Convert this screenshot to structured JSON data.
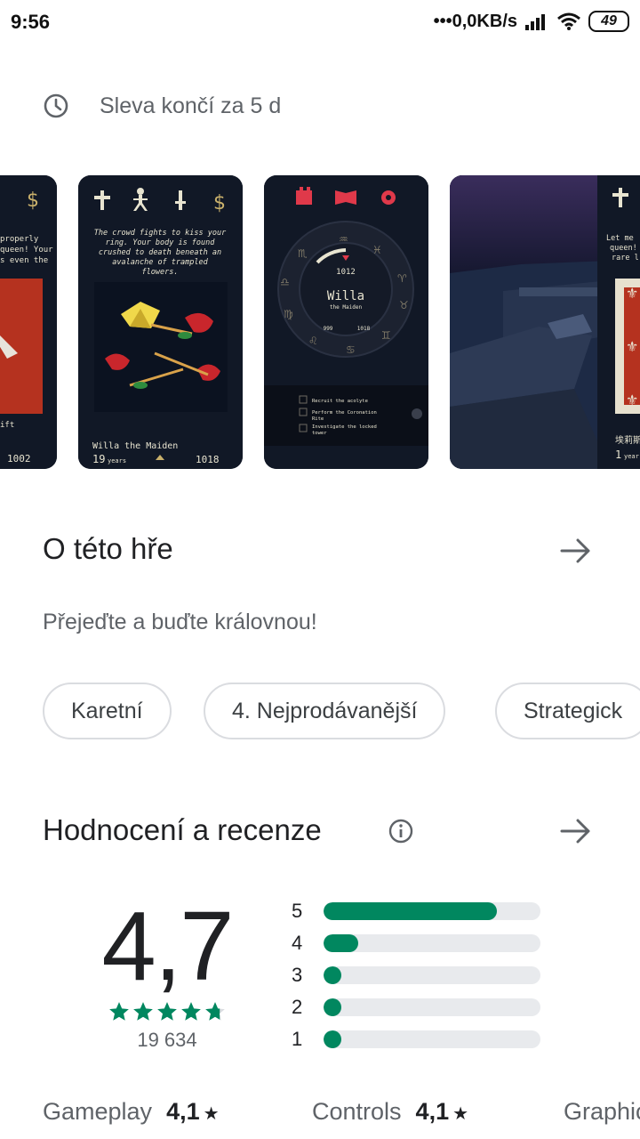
{
  "status_bar": {
    "time": "9:56",
    "network_speed": "0,0KB/s",
    "battery": "49"
  },
  "sale": {
    "text": "Sleva končí za 5 d",
    "icon": "clock-icon"
  },
  "screenshots": {
    "shot1": {
      "caption_a": "properly",
      "caption_b": "queen! Your",
      "caption_c": "s even the",
      "footer_a": "ift",
      "footer_year": "1002"
    },
    "shot2": {
      "story_1": "The crowd fights to kiss your",
      "story_2": "ring. Your body is found",
      "story_3": "crushed to death beneath an",
      "story_4": "avalanche of trampled",
      "story_5": "flowers.",
      "name": "Willa the Maiden",
      "years_num": "19",
      "years_word": "years",
      "year": "1018"
    },
    "shot3": {
      "year": "1012",
      "name": "Willa",
      "subtitle": "the Maiden",
      "left_num": "999",
      "right_num": "1018",
      "tasks": [
        "Recruit the acolyte",
        "Perform the Coronation",
        "Rite",
        "Investigate the locked",
        "tower"
      ]
    },
    "shot4": {
      "caption_a": "Let me",
      "caption_b": "queen!",
      "caption_c": "rare l",
      "footer_name": "埃莉斯",
      "footer_year": "1",
      "footer_word": "year"
    }
  },
  "about": {
    "title": "O této hře",
    "description": "Přejeďte a buďte královnou!"
  },
  "chips": [
    "Karetní",
    "4. Nejprodávanější",
    "Strategick"
  ],
  "ratings": {
    "title": "Hodnocení a recenze",
    "score": "4,7",
    "stars_value": 4.7,
    "review_count": "19 634",
    "distribution": [
      {
        "stars": "5",
        "fraction": 0.8
      },
      {
        "stars": "4",
        "fraction": 0.16
      },
      {
        "stars": "3",
        "fraction": 0.04
      },
      {
        "stars": "2",
        "fraction": 0.04
      },
      {
        "stars": "1",
        "fraction": 0.04
      }
    ],
    "bar_color": "#01875f"
  },
  "sub_ratings": [
    {
      "label": "Gameplay",
      "value": "4,1"
    },
    {
      "label": "Controls",
      "value": "4,1"
    },
    {
      "label": "Graphic",
      "value": ""
    }
  ],
  "colors": {
    "accent": "#01875f",
    "text_secondary": "#5f6368",
    "shot_bg": "#111826",
    "shot_accent": "#e0394a"
  }
}
